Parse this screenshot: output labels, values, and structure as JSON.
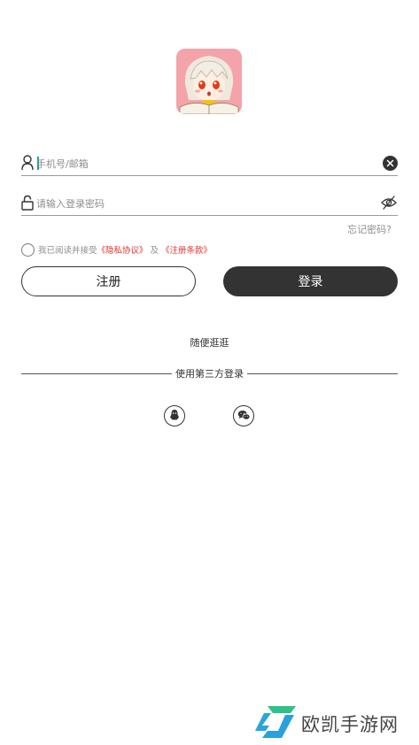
{
  "account_field": {
    "placeholder": "手机号/邮箱",
    "value": ""
  },
  "password_field": {
    "placeholder": "请输入登录密码",
    "value": ""
  },
  "forgot_password": "忘记密码?",
  "agreement": {
    "prefix": "我已阅读并接受",
    "privacy": "《隐私协议》",
    "and": "及",
    "terms": "《注册条款》"
  },
  "buttons": {
    "register": "注册",
    "login": "登录"
  },
  "browse": "随便逛逛",
  "third_party": {
    "label": "使用第三方登录",
    "providers": [
      "qq-icon",
      "wechat-icon"
    ]
  },
  "watermark": {
    "text": "欧凯手游网"
  },
  "colors": {
    "accent_dark": "#333333",
    "link_red": "#e0332d",
    "avatar_bg": "#f5a3aa",
    "cursor": "#1aa39a"
  }
}
